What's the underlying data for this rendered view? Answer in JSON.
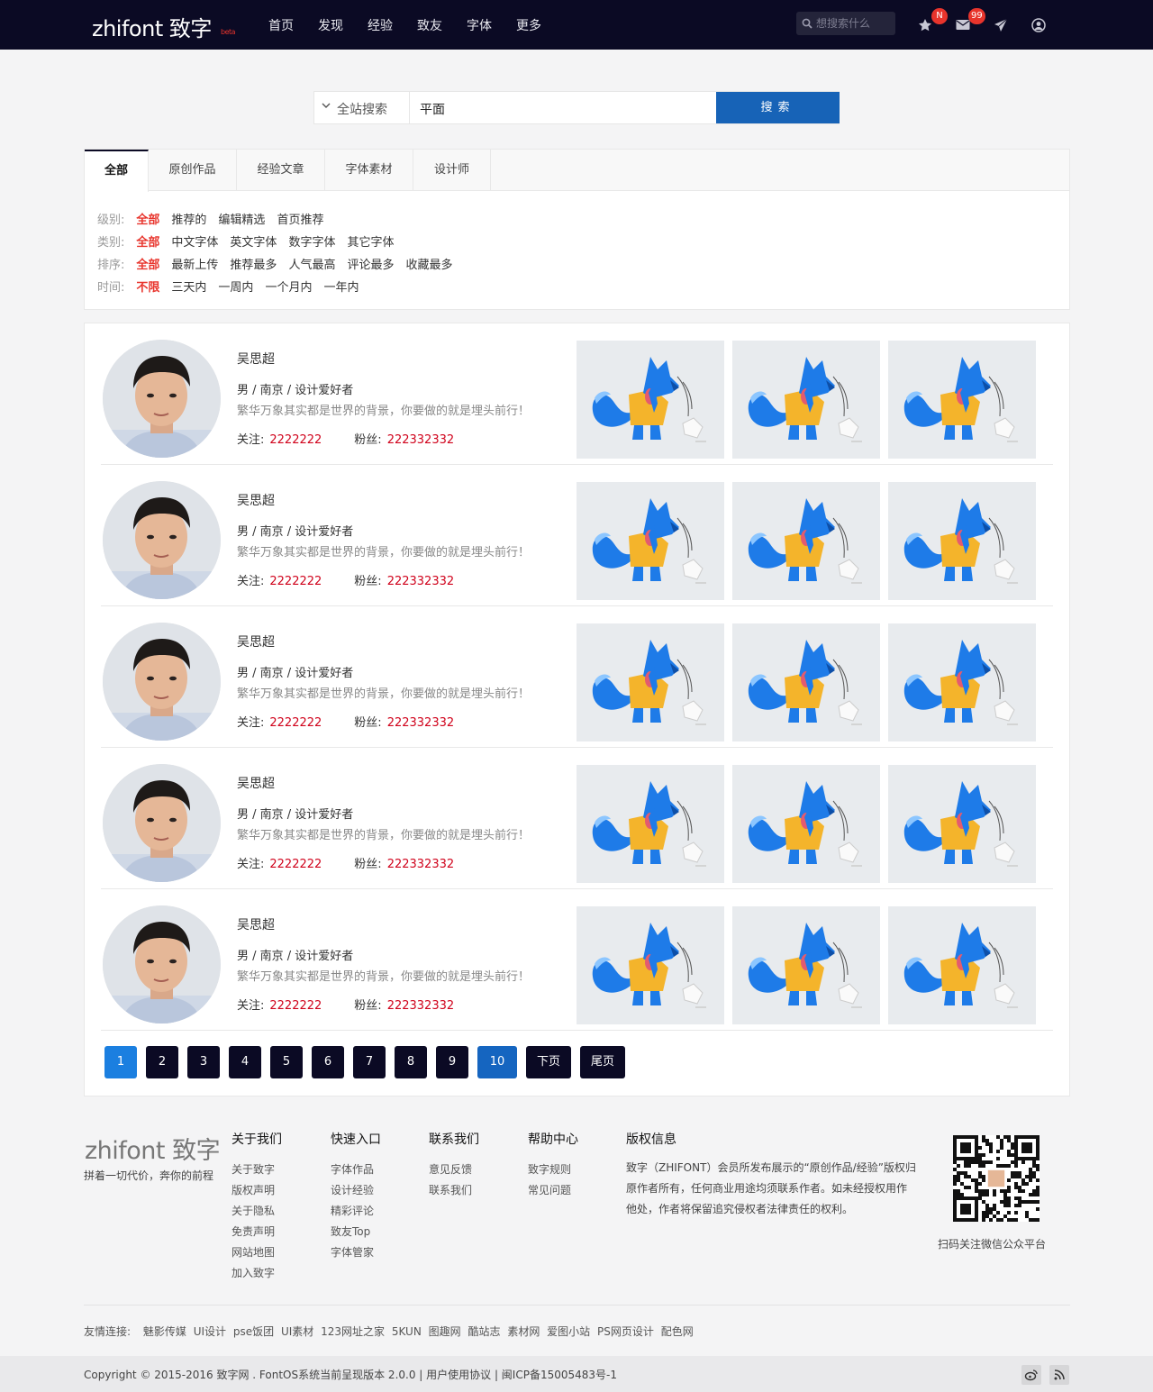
{
  "header": {
    "logo": "zhifont 致字",
    "logo_badge": "beta",
    "nav": [
      "首页",
      "发现",
      "经验",
      "致友",
      "字体",
      "更多"
    ],
    "search_placeholder": "想搜索什么",
    "notif_badge": "N",
    "mail_badge": "99"
  },
  "search": {
    "scope": "全站搜索",
    "query": "平面",
    "button": "搜索"
  },
  "tabs": [
    "全部",
    "原创作品",
    "经验文章",
    "字体素材",
    "设计师"
  ],
  "filters": [
    {
      "label": "级别:",
      "options": [
        "全部",
        "推荐的",
        "编辑精选",
        "首页推荐"
      ],
      "active": 0
    },
    {
      "label": "类别:",
      "options": [
        "全部",
        "中文字体",
        "英文字体",
        "数字字体",
        "其它字体"
      ],
      "active": 0
    },
    {
      "label": "排序:",
      "options": [
        "全部",
        "最新上传",
        "推荐最多",
        "人气最高",
        "评论最多",
        "收藏最多"
      ],
      "active": 0
    },
    {
      "label": "时间:",
      "options": [
        "不限",
        "三天内",
        "一周内",
        "一个月内",
        "一年内"
      ],
      "active": 0
    }
  ],
  "designers": [
    {
      "name": "吴思超",
      "meta": "男 / 南京 / 设计爱好者",
      "motto": "繁华万象其实都是世界的背景，你要做的就是埋头前行！",
      "follow_label": "关注:",
      "follow": "2222222",
      "fans_label": "粉丝:",
      "fans": "222332332"
    },
    {
      "name": "吴思超",
      "meta": "男 / 南京 / 设计爱好者",
      "motto": "繁华万象其实都是世界的背景，你要做的就是埋头前行！",
      "follow_label": "关注:",
      "follow": "2222222",
      "fans_label": "粉丝:",
      "fans": "222332332"
    },
    {
      "name": "吴思超",
      "meta": "男 / 南京 / 设计爱好者",
      "motto": "繁华万象其实都是世界的背景，你要做的就是埋头前行！",
      "follow_label": "关注:",
      "follow": "2222222",
      "fans_label": "粉丝:",
      "fans": "222332332"
    },
    {
      "name": "吴思超",
      "meta": "男 / 南京 / 设计爱好者",
      "motto": "繁华万象其实都是世界的背景，你要做的就是埋头前行！",
      "follow_label": "关注:",
      "follow": "2222222",
      "fans_label": "粉丝:",
      "fans": "222332332"
    },
    {
      "name": "吴思超",
      "meta": "男 / 南京 / 设计爱好者",
      "motto": "繁华万象其实都是世界的背景，你要做的就是埋头前行！",
      "follow_label": "关注:",
      "follow": "2222222",
      "fans_label": "粉丝:",
      "fans": "222332332"
    }
  ],
  "pagination": {
    "pages": [
      "1",
      "2",
      "3",
      "4",
      "5",
      "6",
      "7",
      "8",
      "9",
      "10"
    ],
    "current": "1",
    "next": "下页",
    "last": "尾页"
  },
  "footer": {
    "logo": "zhifont 致字",
    "slogan": "拼着一切代价，奔你的前程",
    "columns": [
      {
        "title": "关于我们",
        "links": [
          "关于致字",
          "版权声明",
          "关于隐私",
          "免责声明",
          "网站地图",
          "加入致字"
        ]
      },
      {
        "title": "快速入口",
        "links": [
          "字体作品",
          "设计经验",
          "精彩评论",
          "致友Top",
          "字体管家"
        ]
      },
      {
        "title": "联系我们",
        "links": [
          "意见反馈",
          "联系我们"
        ]
      },
      {
        "title": "帮助中心",
        "links": [
          "致字规则",
          "常见问题"
        ]
      }
    ],
    "copyright_title": "版权信息",
    "copyright_text": "致字（ZHIFONT）会员所发布展示的“原创作品/经验”版权归原作者所有，任何商业用途均须联系作者。如未经授权用作他处，作者将保留追究侵权者法律责任的权利。",
    "qr_caption": "扫码关注微信公众平台",
    "friends_label": "友情连接:",
    "friends": [
      "魅影传媒",
      "UI设计",
      "pse饭团",
      "UI素材",
      "123网址之家",
      "5KUN",
      "图趣网",
      "酷站志",
      "素材网",
      "爱图小站",
      "PS网页设计",
      "配色网"
    ],
    "bottom": "Copyright © 2015-2016 致字网 . FontOS系统当前呈现版本 2.0.0 | 用户使用协议 | 闽ICP备15005483号-1"
  },
  "colors": {
    "nav_bg": "#0b0a24",
    "accent_red": "#e8342c",
    "search_button": "#1763b7",
    "page_active": "#1b7fe0",
    "stat_red": "#d0021b"
  }
}
